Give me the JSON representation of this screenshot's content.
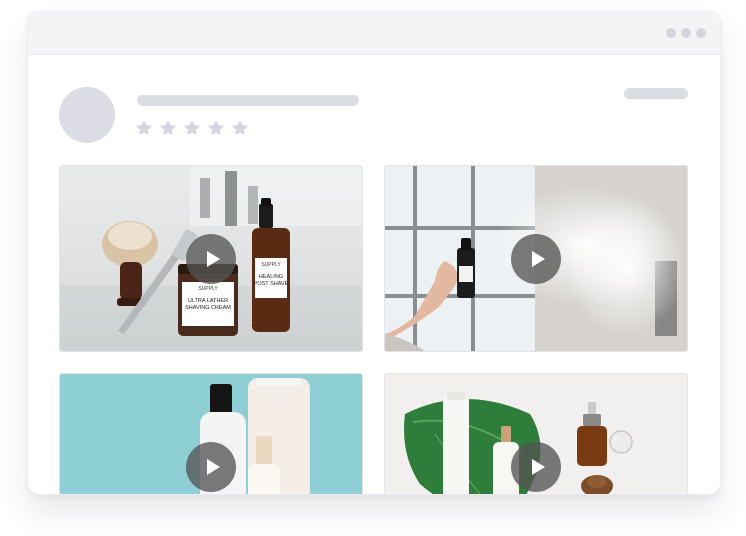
{
  "review": {
    "rating_stars": 5,
    "star_color": "#d5d5dd"
  },
  "window_controls": {
    "dots": 3
  },
  "videos": [
    {
      "name": "shaving-products",
      "brand_left": "SUPPLY",
      "jar_line1": "ULTRA LATHER",
      "jar_line2": "SHAVING CREAM",
      "brand_right": "SUPPLY",
      "bottle_line1": "HEALING",
      "bottle_line2": "POST SHAVE"
    },
    {
      "name": "spray-bottle"
    },
    {
      "name": "lotion-bottles"
    },
    {
      "name": "skincare-flatlay"
    }
  ],
  "colors": {
    "placeholder": "#dcdce4",
    "play_overlay": "#555555",
    "teal_backdrop": "#8ecfd6"
  }
}
